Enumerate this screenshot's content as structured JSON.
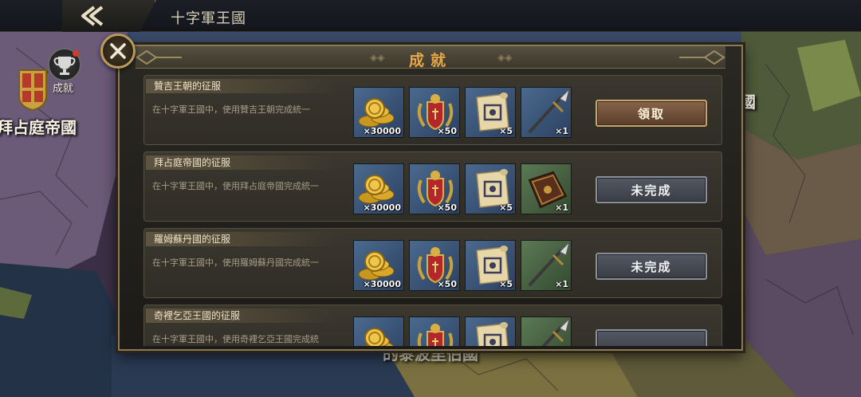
{
  "topbar": {
    "title": "十字軍王國"
  },
  "map": {
    "achievement_label": "成就",
    "region_left": "拜占庭帝國",
    "region_right": "國",
    "region_bottom": "的黎波里伯國"
  },
  "panel": {
    "title": "成就",
    "achievements": [
      {
        "title": "贊吉王朝的征服",
        "desc": "在十字軍王國中，使用贊吉王朝完成統一",
        "button": "領取",
        "status": "claimable",
        "rewards": [
          {
            "icon": "gold-coins-icon",
            "qty": "×30000"
          },
          {
            "icon": "medal-emblem-icon",
            "qty": "×50"
          },
          {
            "icon": "scroll-icon",
            "qty": "×5"
          },
          {
            "icon": "spear-icon",
            "qty": "×1"
          }
        ]
      },
      {
        "title": "拜占庭帝國的征服",
        "desc": "在十字軍王國中，使用拜占庭帝國完成統一",
        "button": "未完成",
        "status": "incomplete",
        "rewards": [
          {
            "icon": "gold-coins-icon",
            "qty": "×30000"
          },
          {
            "icon": "medal-emblem-icon",
            "qty": "×50"
          },
          {
            "icon": "scroll-icon",
            "qty": "×5"
          },
          {
            "icon": "book-icon",
            "qty": "×1"
          }
        ]
      },
      {
        "title": "羅姆蘇丹國的征服",
        "desc": "在十字軍王國中，使用羅姆蘇丹國完成統一",
        "button": "未完成",
        "status": "incomplete",
        "rewards": [
          {
            "icon": "gold-coins-icon",
            "qty": "×30000"
          },
          {
            "icon": "medal-emblem-icon",
            "qty": "×50"
          },
          {
            "icon": "scroll-icon",
            "qty": "×5"
          },
          {
            "icon": "spear-icon",
            "qty": "×1"
          }
        ]
      },
      {
        "title": "奇裡乞亞王國的征服",
        "desc": "在十字軍王國中，使用奇裡乞亞王國完成統",
        "button": "",
        "status": "incomplete",
        "rewards": [
          {
            "icon": "gold-coins-icon",
            "qty": ""
          },
          {
            "icon": "medal-emblem-icon",
            "qty": ""
          },
          {
            "icon": "scroll-icon",
            "qty": ""
          },
          {
            "icon": "spear-icon",
            "qty": ""
          }
        ]
      }
    ]
  },
  "colors": {
    "accent_title": "#e8a64a",
    "claim_button": "#6e4f38",
    "incomplete_button": "#484b54"
  }
}
